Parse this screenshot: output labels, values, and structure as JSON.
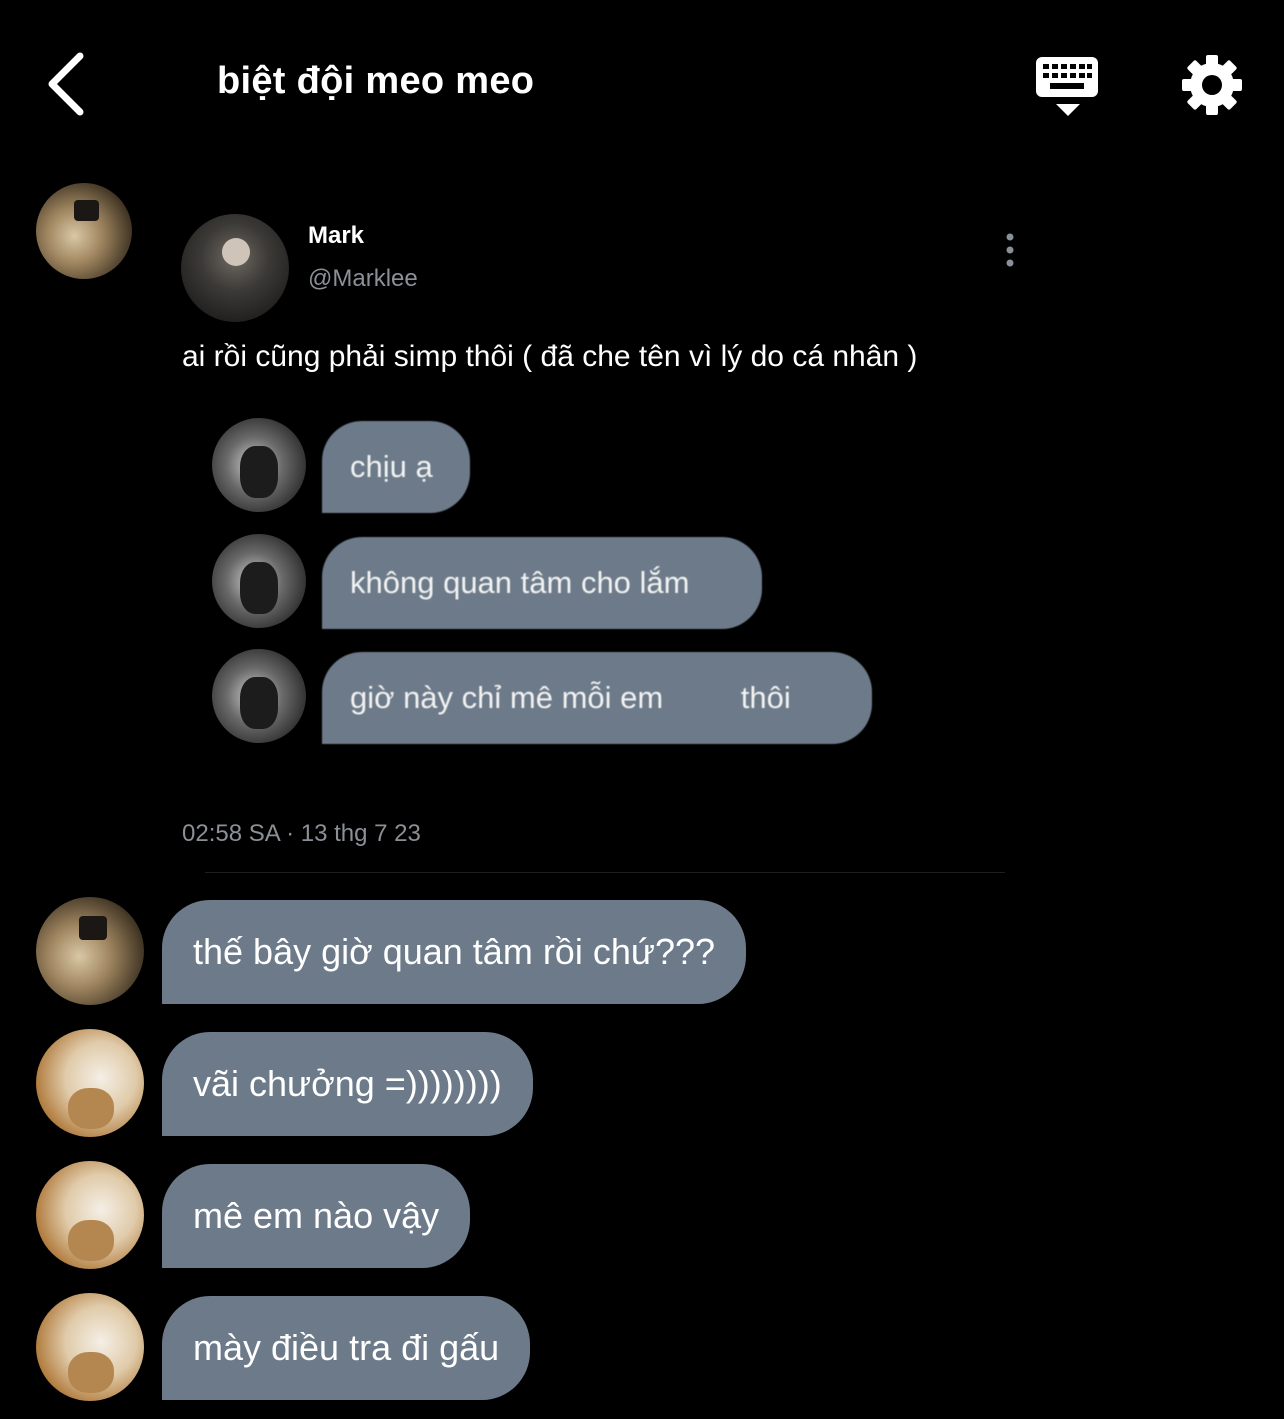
{
  "header": {
    "title": "biệt đội meo meo",
    "icons": {
      "back": "chevron-left-icon",
      "keyboard": "keyboard-icon",
      "settings": "gear-icon"
    }
  },
  "shared_tweet": {
    "author_name": "Mark",
    "author_handle": "@Marklee",
    "text": "ai rồi cũng phải simp thôi ( đã che tên vì lý do cá nhân )",
    "timestamp": "02:58 SA · 13 thg 7 23",
    "embedded_messages": [
      {
        "text": "chịu ạ"
      },
      {
        "text": "không quan tâm cho lắm"
      },
      {
        "text": "giờ này chỉ mê mỗi em         thôi"
      }
    ]
  },
  "messages": [
    {
      "text": "thế bây giờ quan tâm rồi chứ???"
    },
    {
      "text": "vãi chưởng =))))))))"
    },
    {
      "text": "mê em nào vậy"
    },
    {
      "text": "mày điều tra đi gấu"
    }
  ],
  "colors": {
    "background": "#000000",
    "bubble": "#6c7a89",
    "muted_text": "#8b8f96"
  }
}
